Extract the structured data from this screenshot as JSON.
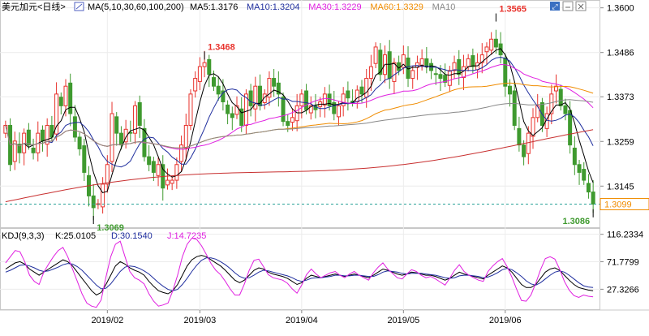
{
  "header": {
    "title": "美元加元<日线>",
    "ma_label": "MA(5,10,30,60,100,200)",
    "ma_values": [
      {
        "label": "MA5:1.3176",
        "color": "#000000"
      },
      {
        "label": "MA10:1.3204",
        "color": "#1f2e9e"
      },
      {
        "label": "MA30:1.3229",
        "color": "#e020e0"
      },
      {
        "label": "MA60:1.3329",
        "color": "#f08c00"
      },
      {
        "label": "MA10",
        "color": "#888888"
      }
    ]
  },
  "kdj_header": {
    "label": "KDJ(9,3,3)",
    "k": "K:25.0105",
    "d": "D:30.1540",
    "j": "J:14.7235"
  },
  "current_price": "1.3099",
  "colors": {
    "up": "#e8322c",
    "down": "#3f9a2f",
    "ma5": "#000000",
    "ma10": "#1f2e9e",
    "ma30": "#e020e0",
    "ma60": "#f08c00",
    "ma100": "#888888",
    "ma200": "#c83030",
    "k": "#000000",
    "d": "#1f2e9e",
    "j": "#e020e0"
  },
  "chart_data": [
    {
      "type": "candlestick",
      "y_ticks": [
        "1.3600",
        "1.3486",
        "1.3373",
        "1.3259",
        "1.3145"
      ],
      "ylim": [
        1.304,
        1.362
      ],
      "x_ticks": [
        {
          "label": "2019/02",
          "index": 22
        },
        {
          "label": "2019/03",
          "index": 42
        },
        {
          "label": "2019/04",
          "index": 64
        },
        {
          "label": "2019/05",
          "index": 86
        },
        {
          "label": "2019/06",
          "index": 108
        }
      ],
      "annotations": [
        {
          "label": "1.3069",
          "index": 19,
          "value": 1.3069,
          "pos": "below"
        },
        {
          "label": "1.3468",
          "index": 43,
          "value": 1.3468,
          "pos": "above"
        },
        {
          "label": "1.3565",
          "index": 106,
          "value": 1.3565,
          "pos": "above"
        },
        {
          "label": "1.3086",
          "index": 127,
          "value": 1.3086,
          "pos": "below"
        }
      ],
      "closes": [
        1.33,
        1.32,
        1.326,
        1.323,
        1.328,
        1.325,
        1.323,
        1.328,
        1.326,
        1.33,
        1.327,
        1.338,
        1.335,
        1.34,
        1.333,
        1.327,
        1.324,
        1.318,
        1.312,
        1.309,
        1.31,
        1.315,
        1.32,
        1.333,
        1.328,
        1.325,
        1.329,
        1.328,
        1.335,
        1.33,
        1.322,
        1.32,
        1.318,
        1.32,
        1.314,
        1.316,
        1.316,
        1.32,
        1.325,
        1.33,
        1.338,
        1.342,
        1.345,
        1.346,
        1.343,
        1.34,
        1.338,
        1.336,
        1.333,
        1.332,
        1.335,
        1.33,
        1.338,
        1.335,
        1.34,
        1.335,
        1.338,
        1.342,
        1.34,
        1.338,
        1.331,
        1.33,
        1.332,
        1.335,
        1.338,
        1.334,
        1.335,
        1.334,
        1.336,
        1.338,
        1.335,
        1.333,
        1.335,
        1.338,
        1.337,
        1.336,
        1.339,
        1.338,
        1.342,
        1.345,
        1.35,
        1.343,
        1.348,
        1.342,
        1.346,
        1.344,
        1.348,
        1.342,
        1.344,
        1.346,
        1.347,
        1.345,
        1.344,
        1.343,
        1.342,
        1.341,
        1.344,
        1.346,
        1.343,
        1.345,
        1.347,
        1.345,
        1.346,
        1.348,
        1.35,
        1.352,
        1.35,
        1.348,
        1.34,
        1.338,
        1.33,
        1.325,
        1.322,
        1.328,
        1.332,
        1.335,
        1.33,
        1.333,
        1.338,
        1.34,
        1.335,
        1.333,
        1.325,
        1.32,
        1.318,
        1.316,
        1.313,
        1.3099
      ]
    },
    {
      "type": "line",
      "title": "KDJ(9,3,3)",
      "y_ticks": [
        "116.2334",
        "71.7799",
        "27.3266"
      ],
      "ylim": [
        -5,
        125
      ],
      "series": [
        {
          "name": "K",
          "values": [
            60,
            65,
            70,
            72,
            68,
            60,
            55,
            50,
            55,
            60,
            65,
            70,
            75,
            72,
            65,
            55,
            45,
            35,
            25,
            18,
            22,
            35,
            50,
            65,
            72,
            68,
            62,
            58,
            55,
            50,
            40,
            32,
            25,
            22,
            20,
            25,
            35,
            50,
            65,
            75,
            80,
            82,
            80,
            75,
            70,
            65,
            58,
            50,
            42,
            38,
            42,
            50,
            58,
            62,
            60,
            55,
            52,
            50,
            48,
            45,
            40,
            35,
            38,
            45,
            50,
            48,
            46,
            48,
            50,
            52,
            50,
            48,
            50,
            52,
            50,
            48,
            46,
            50,
            55,
            60,
            58,
            55,
            52,
            50,
            52,
            55,
            54,
            52,
            50,
            50,
            48,
            45,
            42,
            45,
            50,
            55,
            52,
            50,
            48,
            46,
            44,
            50,
            55,
            60,
            65,
            62,
            55,
            45,
            35,
            30,
            30,
            35,
            45,
            55,
            60,
            62,
            58,
            50,
            42,
            35,
            30,
            28,
            26,
            25
          ]
        },
        {
          "name": "D",
          "values": [
            55,
            58,
            62,
            66,
            67,
            65,
            62,
            58,
            56,
            57,
            60,
            63,
            67,
            69,
            68,
            64,
            58,
            50,
            42,
            34,
            28,
            29,
            36,
            46,
            56,
            63,
            65,
            64,
            61,
            57,
            52,
            45,
            38,
            32,
            27,
            25,
            27,
            35,
            45,
            56,
            66,
            74,
            78,
            78,
            76,
            72,
            67,
            61,
            54,
            48,
            45,
            46,
            50,
            55,
            58,
            57,
            55,
            53,
            51,
            49,
            46,
            42,
            40,
            42,
            45,
            46,
            46,
            47,
            48,
            50,
            50,
            49,
            49,
            50,
            50,
            49,
            48,
            48,
            51,
            55,
            57,
            56,
            55,
            53,
            52,
            53,
            53,
            53,
            52,
            51,
            50,
            48,
            46,
            45,
            46,
            49,
            50,
            50,
            49,
            48,
            46,
            47,
            50,
            54,
            59,
            61,
            59,
            54,
            48,
            41,
            36,
            34,
            38,
            44,
            50,
            55,
            57,
            55,
            50,
            44,
            38,
            33,
            31,
            30
          ]
        },
        {
          "name": "J",
          "values": [
            70,
            80,
            90,
            88,
            72,
            50,
            40,
            35,
            55,
            68,
            80,
            90,
            95,
            80,
            60,
            40,
            20,
            5,
            0,
            -2,
            10,
            47,
            80,
            100,
            105,
            80,
            56,
            46,
            42,
            36,
            20,
            8,
            0,
            2,
            5,
            25,
            50,
            80,
            100,
            110,
            108,
            98,
            84,
            69,
            58,
            51,
            40,
            28,
            18,
            18,
            36,
            58,
            74,
            76,
            64,
            51,
            46,
            44,
            42,
            37,
            28,
            21,
            34,
            51,
            60,
            52,
            46,
            50,
            54,
            56,
            50,
            46,
            52,
            56,
            50,
            46,
            42,
            54,
            63,
            70,
            60,
            53,
            46,
            44,
            52,
            59,
            56,
            50,
            46,
            48,
            44,
            39,
            34,
            45,
            58,
            67,
            56,
            50,
            46,
            42,
            40,
            56,
            65,
            72,
            77,
            64,
            47,
            27,
            9,
            8,
            18,
            37,
            59,
            77,
            80,
            76,
            60,
            40,
            26,
            17,
            14,
            18,
            16,
            15
          ]
        }
      ]
    }
  ]
}
